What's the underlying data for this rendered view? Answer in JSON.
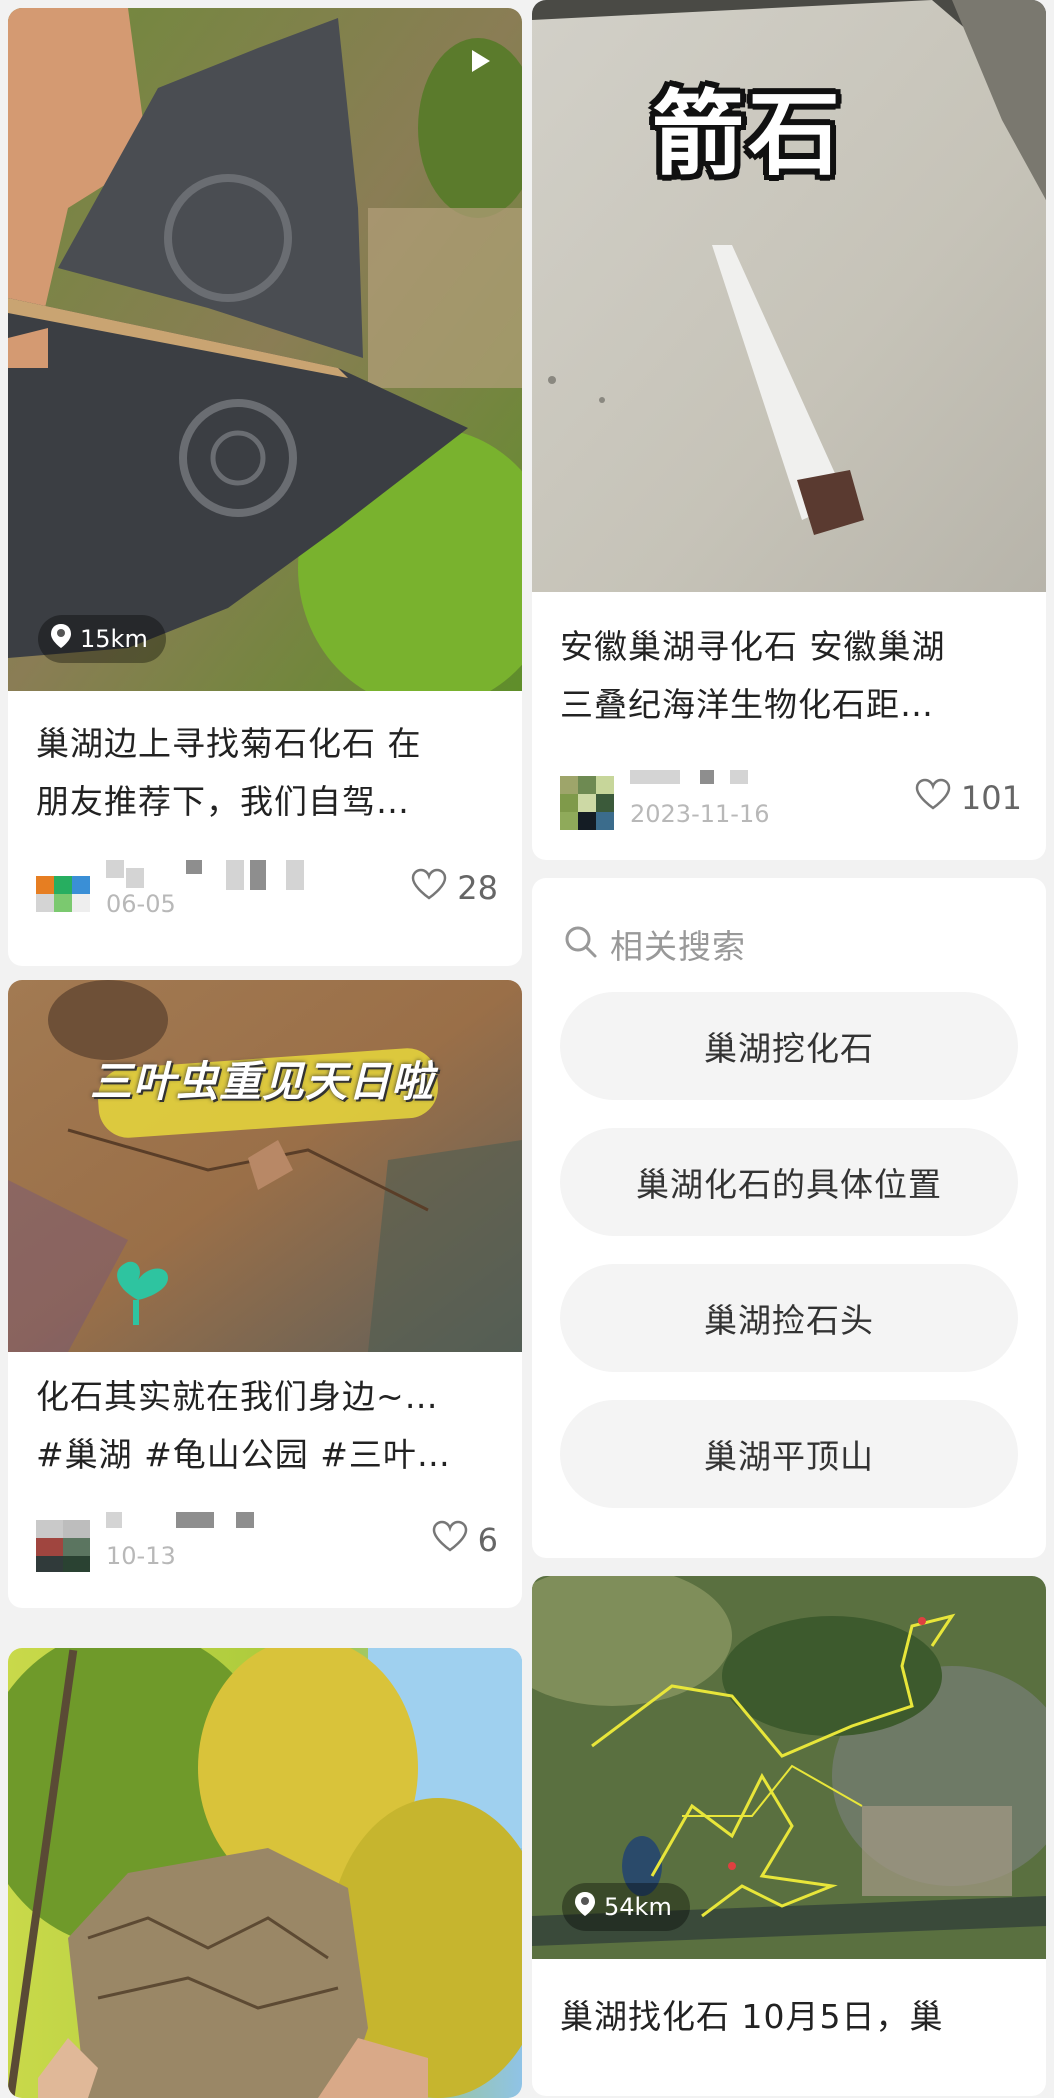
{
  "cards": [
    {
      "title_line1": "巢湖边上寻找菊石化石 在",
      "title_line2": "朋友推荐下，我们自驾…",
      "distance": "15km",
      "date": "06-05",
      "likes": "28"
    },
    {
      "title_line1": "安徽巢湖寻化石 安徽巢湖",
      "title_line2": "三叠纪海洋生物化石距…",
      "overlay_text": "箭石",
      "date": "2023-11-16",
      "likes": "101"
    },
    {
      "title_line1": "化石其实就在我们身边~…",
      "title_line2": "#巢湖 #龟山公园 #三叶…",
      "overlay_text": "三叶虫重见天日啦",
      "date": "10-13",
      "likes": "6"
    },
    {
      "title_line1": "巢湖找化石 10月5日，巢",
      "distance": "54km"
    }
  ],
  "related": {
    "label": "相关搜索",
    "items": [
      "巢湖挖化石",
      "巢湖化石的具体位置",
      "巢湖捡石头",
      "巢湖平顶山"
    ]
  },
  "colors": {
    "accent_yellow": "#f1e63a",
    "text": "#222222",
    "muted": "#b8b8b8"
  }
}
